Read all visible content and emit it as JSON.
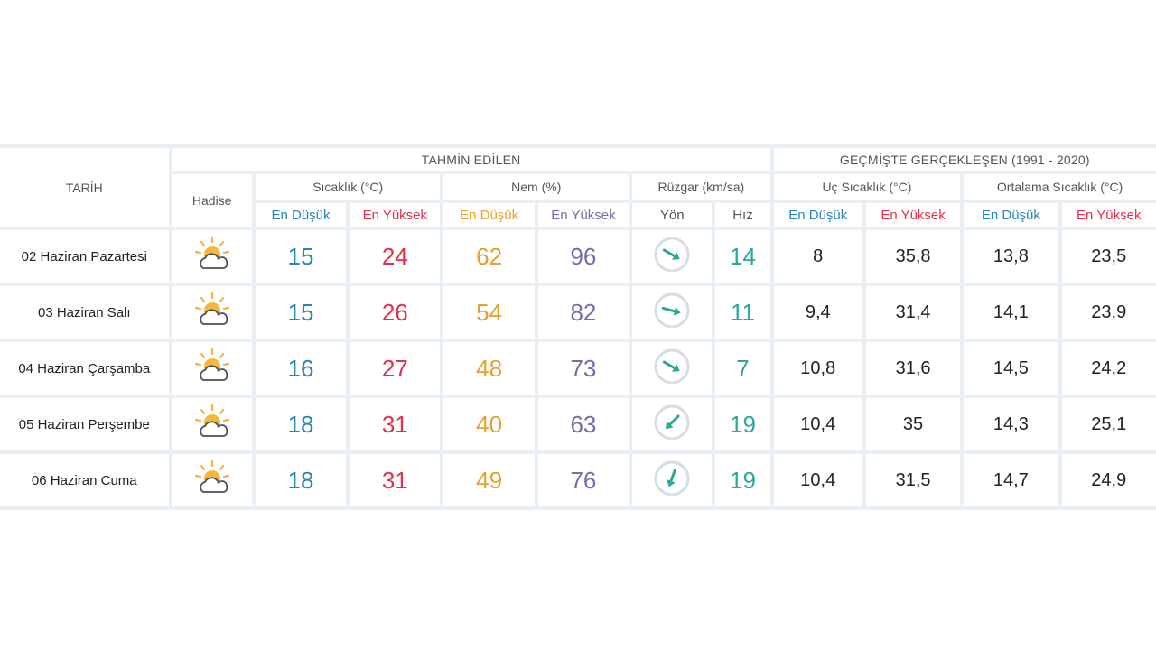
{
  "headers": {
    "tarih": "TARİH",
    "hadise": "Hadise",
    "forecast_group": "TAHMİN EDİLEN",
    "history_group": "GEÇMİŞTE GERÇEKLEŞEN (1991 - 2020)",
    "sicaklik": "Sıcaklık (°C)",
    "nem": "Nem (%)",
    "ruzgar": "Rüzgar (km/sa)",
    "uc_sicaklik": "Uç Sıcaklık (°C)",
    "ortalama_sicaklik": "Ortalama Sıcaklık (°C)",
    "en_dusuk": "En Düşük",
    "en_yuksek": "En Yüksek",
    "yon": "Yön",
    "hiz": "Hız"
  },
  "colors": {
    "low": "#2a84b4",
    "high": "#e0304e",
    "humidity_low": "#e3a12f",
    "humidity_high": "#7a6aa8",
    "wind": "#2aa89a"
  },
  "rows": [
    {
      "date": "02 Haziran Pazartesi",
      "icon": "partly-cloudy-icon",
      "t_min": "15",
      "t_max": "24",
      "h_min": "62",
      "h_max": "96",
      "wind_dir_deg": 120,
      "wind_speed": "14",
      "extreme_min": "8",
      "extreme_max": "35,8",
      "avg_min": "13,8",
      "avg_max": "23,5"
    },
    {
      "date": "03 Haziran Salı",
      "icon": "partly-cloudy-icon",
      "t_min": "15",
      "t_max": "26",
      "h_min": "54",
      "h_max": "82",
      "wind_dir_deg": 105,
      "wind_speed": "11",
      "extreme_min": "9,4",
      "extreme_max": "31,4",
      "avg_min": "14,1",
      "avg_max": "23,9"
    },
    {
      "date": "04 Haziran Çarşamba",
      "icon": "partly-cloudy-icon",
      "t_min": "16",
      "t_max": "27",
      "h_min": "48",
      "h_max": "73",
      "wind_dir_deg": 120,
      "wind_speed": "7",
      "extreme_min": "10,8",
      "extreme_max": "31,6",
      "avg_min": "14,5",
      "avg_max": "24,2"
    },
    {
      "date": "05 Haziran Perşembe",
      "icon": "partly-cloudy-icon",
      "t_min": "18",
      "t_max": "31",
      "h_min": "40",
      "h_max": "63",
      "wind_dir_deg": 225,
      "wind_speed": "19",
      "extreme_min": "10,4",
      "extreme_max": "35",
      "avg_min": "14,3",
      "avg_max": "25,1"
    },
    {
      "date": "06 Haziran Cuma",
      "icon": "partly-cloudy-icon",
      "t_min": "18",
      "t_max": "31",
      "h_min": "49",
      "h_max": "76",
      "wind_dir_deg": 200,
      "wind_speed": "19",
      "extreme_min": "10,4",
      "extreme_max": "31,5",
      "avg_min": "14,7",
      "avg_max": "24,9"
    }
  ]
}
